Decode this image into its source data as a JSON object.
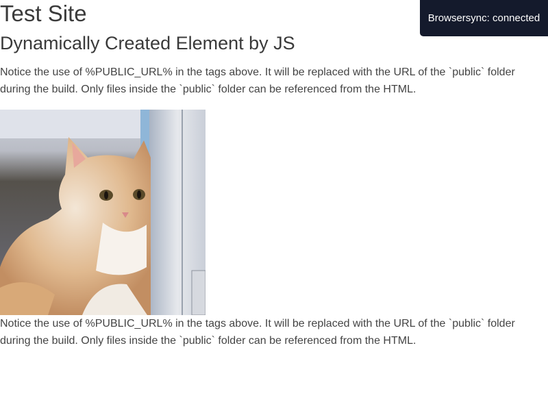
{
  "page": {
    "title": "Test Site",
    "subtitle": "Dynamically Created Element by JS",
    "paragraph_1": "Notice the use of %PUBLIC_URL% in the tags above. It will be replaced with the URL of the `public` folder during the build. Only files inside the `public` folder can be referenced from the HTML.",
    "paragraph_2": "Notice the use of %PUBLIC_URL% in the tags above. It will be replaced with the URL of the `public` folder during the build. Only files inside the `public` folder can be referenced from the HTML."
  },
  "image": {
    "subject": "kitten peeking around wooden post"
  },
  "toast": {
    "text": "Browsersync: connected",
    "background": "#141a2c"
  }
}
